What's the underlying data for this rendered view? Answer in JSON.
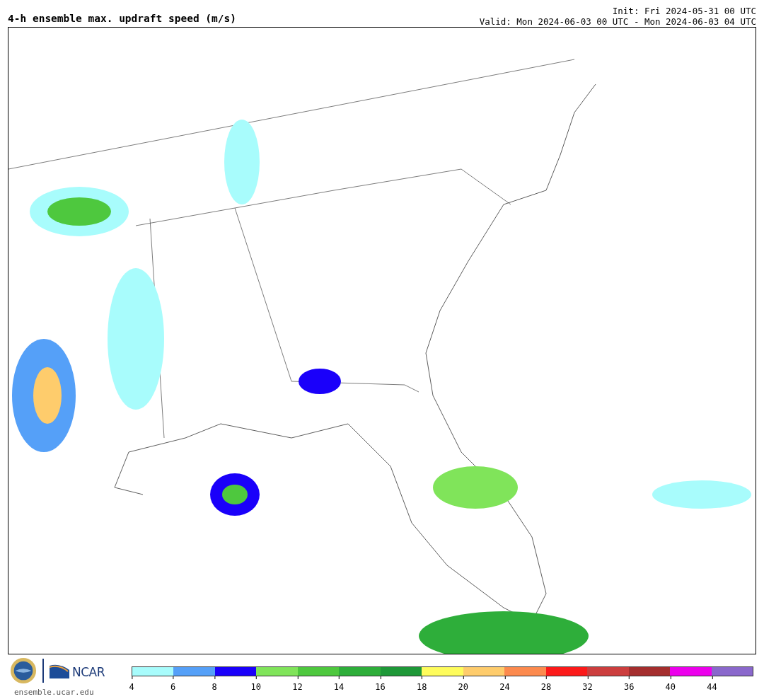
{
  "header": {
    "title": "4-h ensemble max. updraft speed (m/s)",
    "init": "Init: Fri 2024-05-31 00 UTC",
    "valid": "Valid: Mon 2024-06-03 00 UTC - Mon 2024-06-03 04 UTC"
  },
  "footer": {
    "logo_text": "NCAR",
    "site": "ensemble.ucar.edu"
  },
  "legend": {
    "bins": [
      {
        "color": "#a8fcfc"
      },
      {
        "color": "#55a0f8"
      },
      {
        "color": "#1a00fa"
      },
      {
        "color": "#80e45a"
      },
      {
        "color": "#4ec83e"
      },
      {
        "color": "#2eae3a"
      },
      {
        "color": "#1e9838"
      },
      {
        "color": "#fefc5c"
      },
      {
        "color": "#fecc6c"
      },
      {
        "color": "#fc8a4e"
      },
      {
        "color": "#fc1a1a"
      },
      {
        "color": "#cc3e3e"
      },
      {
        "color": "#a42e2e"
      },
      {
        "color": "#ec00ec"
      },
      {
        "color": "#8a68cc"
      }
    ],
    "ticks": [
      "4",
      "6",
      "8",
      "10",
      "12",
      "14",
      "16",
      "18",
      "20",
      "24",
      "28",
      "32",
      "36",
      "40",
      "44"
    ]
  }
}
